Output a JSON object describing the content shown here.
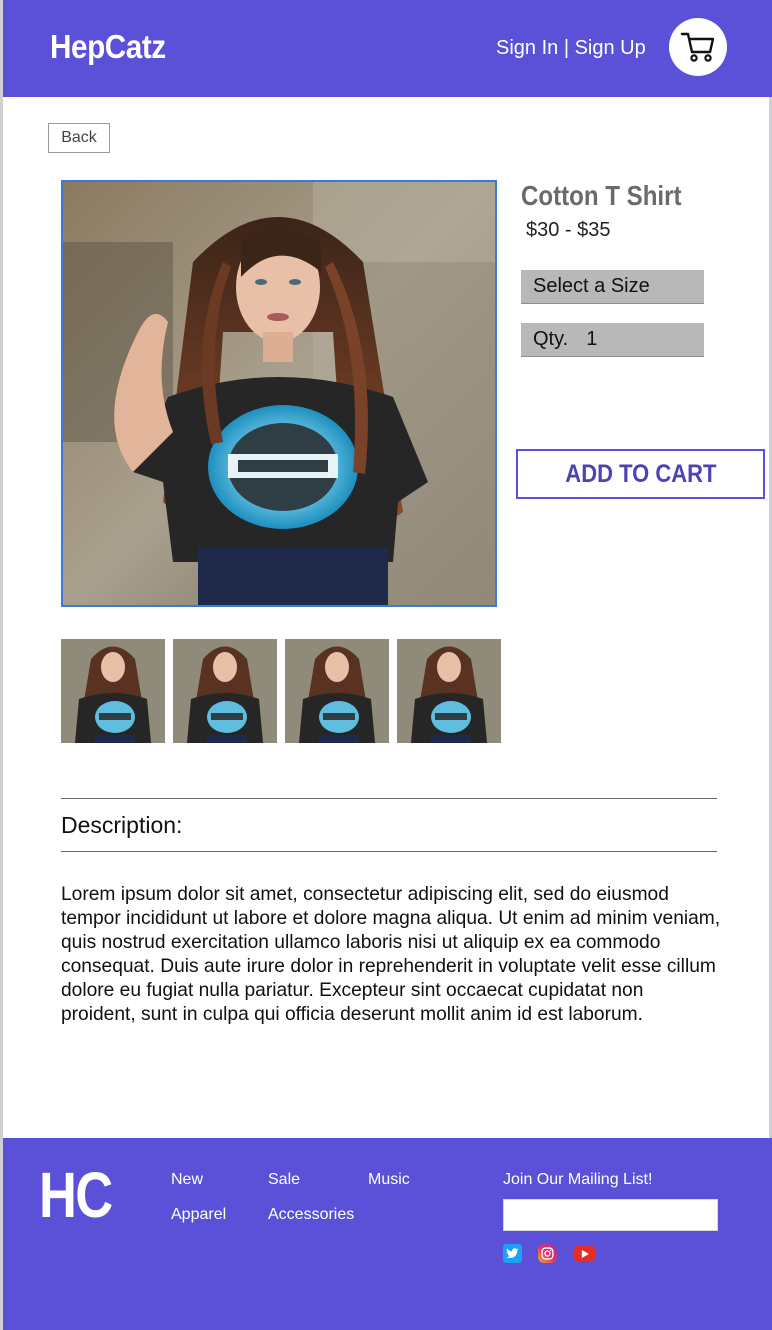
{
  "header": {
    "brand": "HepCatz",
    "auth_text": "Sign In | Sign Up",
    "cart_icon": "shopping-cart-icon"
  },
  "back_label": "Back",
  "product": {
    "title": "Cotton T Shirt",
    "price": "$30 - $35",
    "size_label": "Select a Size",
    "qty_label": "Qty.",
    "qty_value": "1",
    "add_to_cart_label": "ADD TO CART",
    "thumbnail_count": 4
  },
  "description": {
    "label": "Description:",
    "text": "Lorem ipsum dolor sit amet, consectetur adipiscing elit, sed do eiusmod tempor incididunt ut labore et dolore magna aliqua. Ut enim ad minim veniam, quis nostrud exercitation ullamco laboris nisi ut aliquip ex ea commodo consequat. Duis aute irure dolor in reprehenderit in voluptate velit esse cillum dolore eu fugiat nulla pariatur. Excepteur sint occaecat cupidatat non proident, sunt in culpa qui officia deserunt mollit anim id est laborum."
  },
  "footer": {
    "logo": "HC",
    "links": [
      "New",
      "Sale",
      "Music",
      "Apparel",
      "Accessories"
    ],
    "mailing_label": "Join Our Mailing List!",
    "mailing_value": "",
    "social_icons": [
      "twitter-icon",
      "instagram-icon",
      "youtube-icon"
    ]
  },
  "colors": {
    "brand": "#5b51d9",
    "image_border": "#3a7bd5",
    "select_bg": "#b8b8b8"
  }
}
